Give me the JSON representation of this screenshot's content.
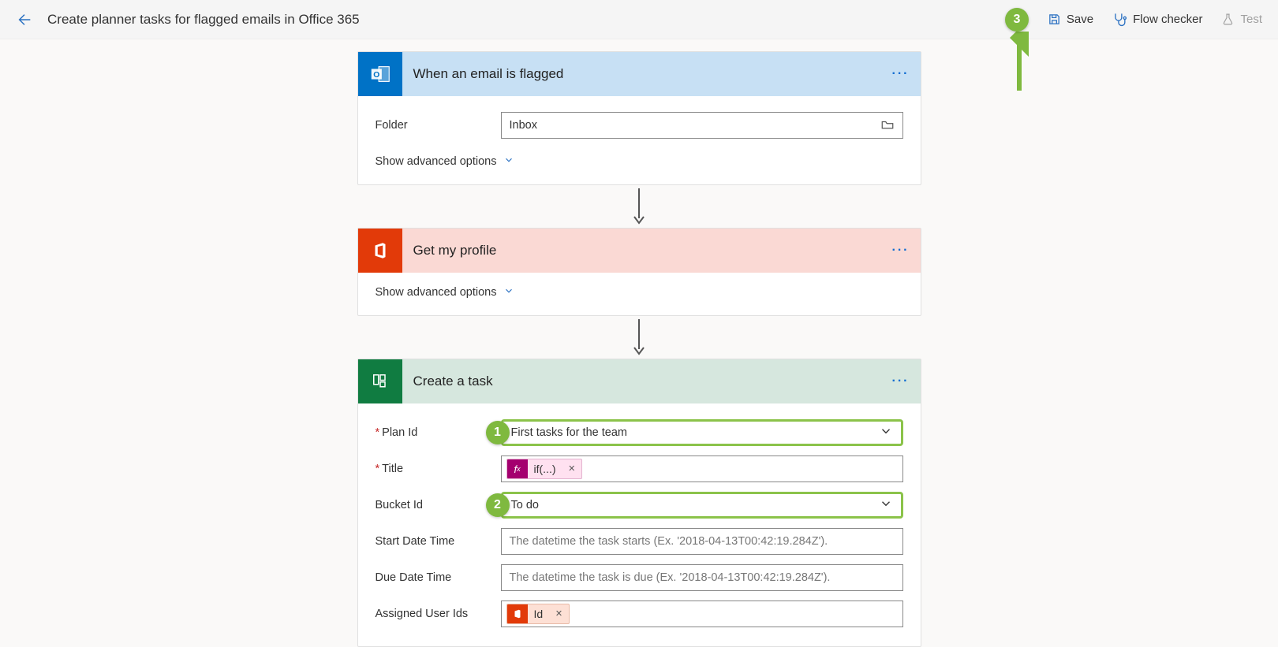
{
  "header": {
    "title": "Create planner tasks for flagged emails in Office 365",
    "save": "Save",
    "checker": "Flow checker",
    "test": "Test"
  },
  "callouts": {
    "c1": "1",
    "c2": "2",
    "c3": "3"
  },
  "cards": [
    {
      "title": "When an email is flagged",
      "advanced": "Show advanced options",
      "fields": {
        "folder_label": "Folder",
        "folder_value": "Inbox"
      }
    },
    {
      "title": "Get my profile",
      "advanced": "Show advanced options"
    },
    {
      "title": "Create a task",
      "fields": {
        "planid_label": "Plan Id",
        "planid_value": "First tasks for the team",
        "title_label": "Title",
        "title_token": "if(...)",
        "bucket_label": "Bucket Id",
        "bucket_value": "To do",
        "start_label": "Start Date Time",
        "start_ph": "The datetime the task starts (Ex. '2018-04-13T00:42:19.284Z').",
        "due_label": "Due Date Time",
        "due_ph": "The datetime the task is due (Ex. '2018-04-13T00:42:19.284Z').",
        "assigned_label": "Assigned User Ids",
        "assigned_token": "Id"
      }
    }
  ]
}
